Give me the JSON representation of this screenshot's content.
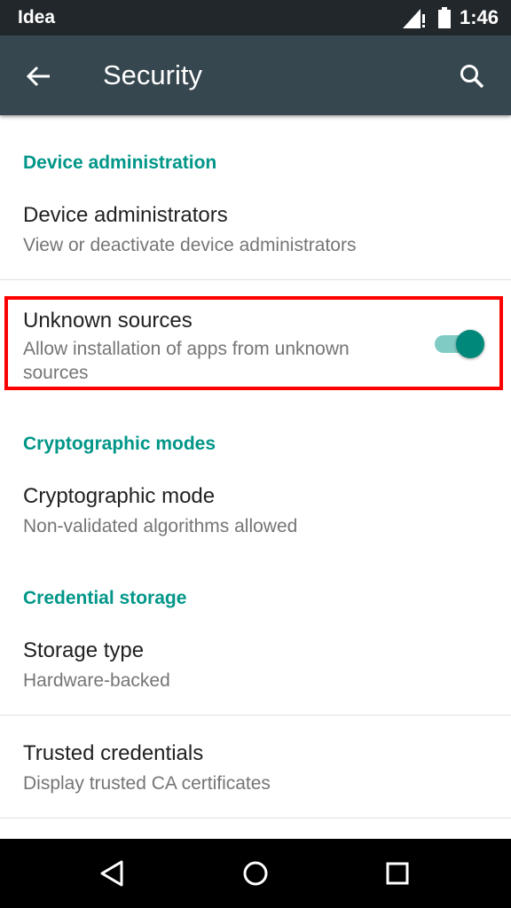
{
  "status_bar": {
    "carrier": "Idea",
    "time": "1:46",
    "icons": [
      "signal-icon",
      "battery-icon"
    ]
  },
  "app_bar": {
    "title": "Security",
    "icons": [
      "back-arrow-icon",
      "search-icon"
    ]
  },
  "sections": [
    {
      "header": "Device administration",
      "items": [
        {
          "title": "Device administrators",
          "summary": "View or deactivate device administrators"
        },
        {
          "title": "Unknown sources",
          "summary_line1": "Allow installation of apps from unknown",
          "summary_line2": "sources",
          "toggle": true
        }
      ]
    },
    {
      "header": "Cryptographic modes",
      "items": [
        {
          "title": "Cryptographic mode",
          "summary": "Non-validated algorithms allowed"
        }
      ]
    },
    {
      "header": "Credential storage",
      "items": [
        {
          "title": "Storage type",
          "summary": "Hardware-backed"
        },
        {
          "title": "Trusted credentials",
          "summary": "Display trusted CA certificates"
        }
      ]
    }
  ],
  "nav_bar": {
    "icons": [
      "back-triangle-icon",
      "home-circle-icon",
      "recents-square-icon"
    ]
  },
  "colors": {
    "accent": "#009688",
    "toolbar": "#37474f",
    "status_bar": "#21272b",
    "highlight": "#ff0000",
    "toggle_thumb": "#00897b",
    "toggle_track": "#80cbc4"
  }
}
